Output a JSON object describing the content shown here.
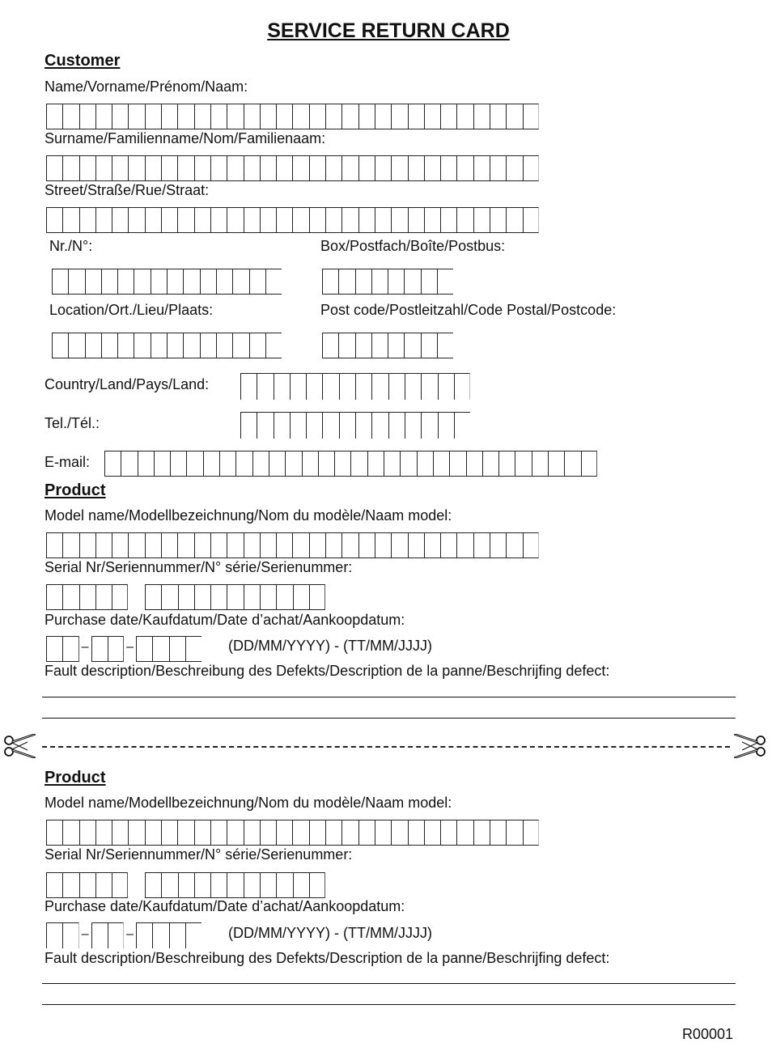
{
  "title": "SERVICE RETURN CARD",
  "customer": {
    "heading": "Customer",
    "name_label": "Name/Vorname/Prénom/Naam:",
    "surname_label": "Surname/Familienname/Nom/Familienaam:",
    "street_label": "Street/Straße/Rue/Straat:",
    "number_label": "Nr./N°:",
    "box_label": "Box/Postfach/Boîte/Postbus:",
    "location_label": "Location/Ort./Lieu/Plaats:",
    "postcode_label": "Post code/Postleitzahl/Code Postal/Postcode:",
    "country_label": "Country/Land/Pays/Land:",
    "tel_label": "Tel./Tél.:",
    "email_label": "E-mail:"
  },
  "product_top": {
    "heading": "Product",
    "model_label": "Model name/Modellbezeichnung/Nom du modèle/Naam model:",
    "serial_label": "Serial Nr/Seriennummer/N° série/Serienummer:",
    "purchase_label": "Purchase date/Kaufdatum/Date d’achat/Aankoopdatum:",
    "date_format": "(DD/MM/YYYY) - (TT/MM/JJJJ)",
    "date_separator": "–",
    "fault_label": "Fault description/Beschreibung des Defekts/Description de la panne/Beschrijfing defect:"
  },
  "product_bottom": {
    "heading": "Product",
    "model_label": "Model name/Modellbezeichnung/Nom du modèle/Naam model:",
    "serial_label": "Serial Nr/Seriennummer/N° série/Serienummer:",
    "purchase_label": "Purchase date/Kaufdatum/Date d’achat/Aankoopdatum:",
    "date_format": "(DD/MM/YYYY) - (TT/MM/JJJJ)",
    "date_separator": "–",
    "fault_label": "Fault description/Beschreibung des Defekts/Description de la panne/Beschrijfing defect:"
  },
  "cell_counts": {
    "name": 30,
    "surname": 30,
    "street": 30,
    "number": 14,
    "box": 8,
    "location": 14,
    "postcode": 8,
    "country": 14,
    "tel": 14,
    "email": 30,
    "model": 30,
    "serial_a": 5,
    "serial_b": 11,
    "date_day": 2,
    "date_month": 2,
    "date_year": 4
  },
  "cut_line_icon": "scissors-icon",
  "reference_code": "R00001"
}
